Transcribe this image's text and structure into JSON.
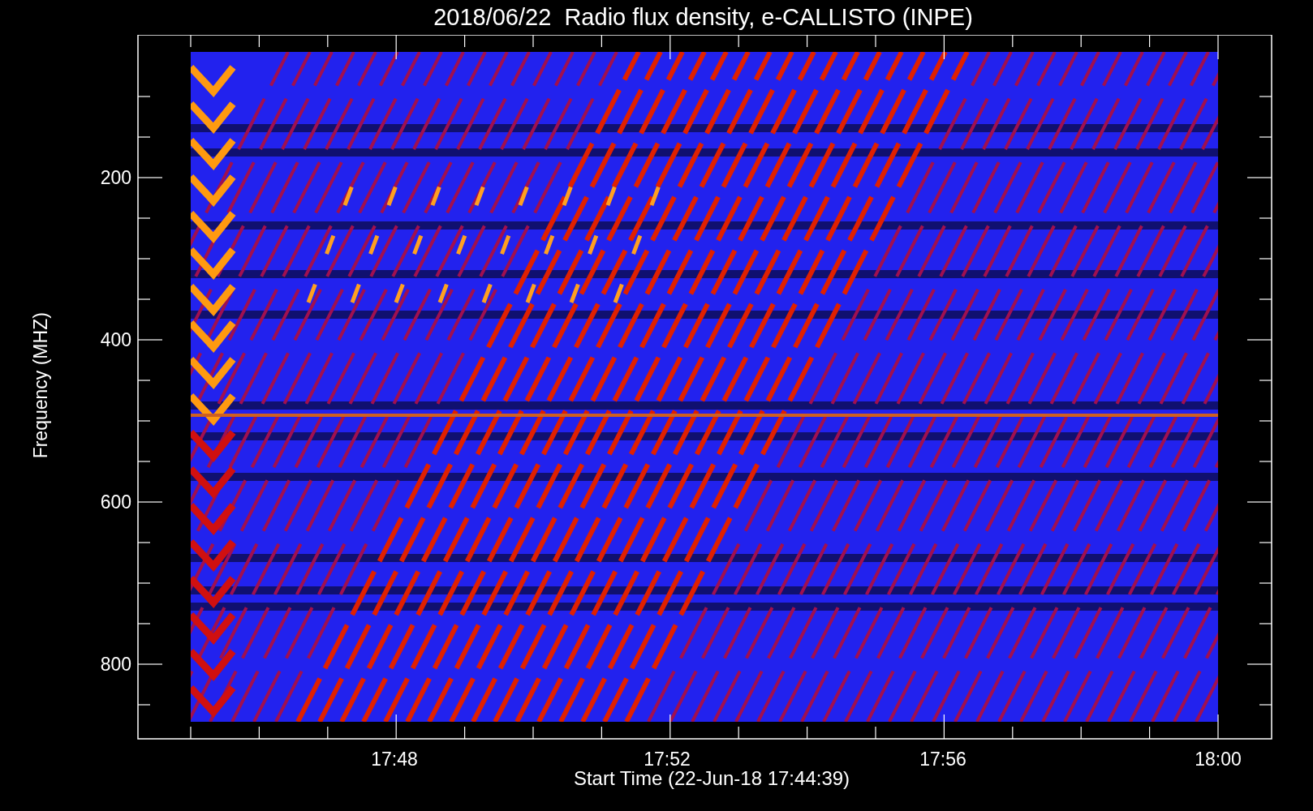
{
  "title": "2018/06/22  Radio flux density, e-CALLISTO (INPE)",
  "y_axis": {
    "label": "Frequency (MHZ)",
    "ticks": [
      "200",
      "400",
      "600",
      "800"
    ]
  },
  "x_axis": {
    "label": "Start Time (22-Jun-18 17:44:39)",
    "ticks": [
      "17:48",
      "17:52",
      "17:56",
      "18:00"
    ]
  }
}
